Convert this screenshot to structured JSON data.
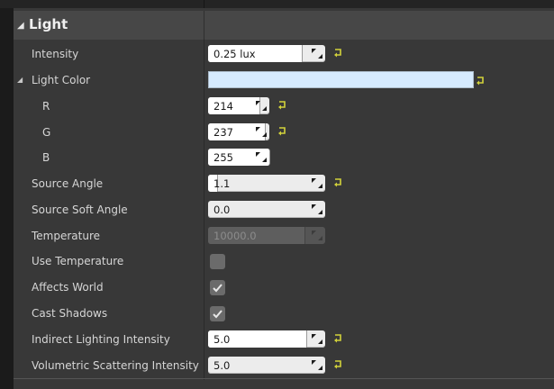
{
  "category": {
    "title": "Light"
  },
  "properties": [
    {
      "id": "intensity",
      "label": "Intensity",
      "value": "0.25 lux",
      "fill": 0.8,
      "reset": true
    },
    {
      "id": "light-color",
      "label": "Light Color",
      "color": "#d6ebff",
      "reset": true
    },
    {
      "id": "r",
      "label": "R",
      "value": "214",
      "fill": 0.84,
      "reset": true
    },
    {
      "id": "g",
      "label": "G",
      "value": "237",
      "fill": 0.93,
      "reset": true
    },
    {
      "id": "b",
      "label": "B",
      "value": "255",
      "fill": 1.0,
      "reset": false
    },
    {
      "id": "source-angle",
      "label": "Source Angle",
      "value": "1.1",
      "fill": 0.08,
      "reset": true
    },
    {
      "id": "source-soft-angle",
      "label": "Source Soft Angle",
      "value": "0.0",
      "fill": 0.0,
      "reset": false
    },
    {
      "id": "temperature",
      "label": "Temperature",
      "value": "10000.0",
      "fill": 0.82,
      "disabled": true,
      "reset": false
    },
    {
      "id": "use-temperature",
      "label": "Use Temperature",
      "checked": false
    },
    {
      "id": "affects-world",
      "label": "Affects World",
      "checked": true
    },
    {
      "id": "cast-shadows",
      "label": "Cast Shadows",
      "checked": true
    },
    {
      "id": "indirect-lighting-intensity",
      "label": "Indirect Lighting Intensity",
      "value": "5.0",
      "fill": 0.84,
      "reset": true
    },
    {
      "id": "volumetric-scattering-intensity",
      "label": "Volumetric Scattering Intensity",
      "value": "5.0",
      "fill": 0.0,
      "reset": true
    }
  ],
  "icons": {
    "expand": "triangle-down-icon",
    "spin": "spin-arrows-icon",
    "reset": "reset-to-default-icon",
    "check": "checkmark-icon"
  },
  "colors": {
    "reset_icon": "#d2d23a",
    "panel": "#383838",
    "header": "#474747"
  }
}
